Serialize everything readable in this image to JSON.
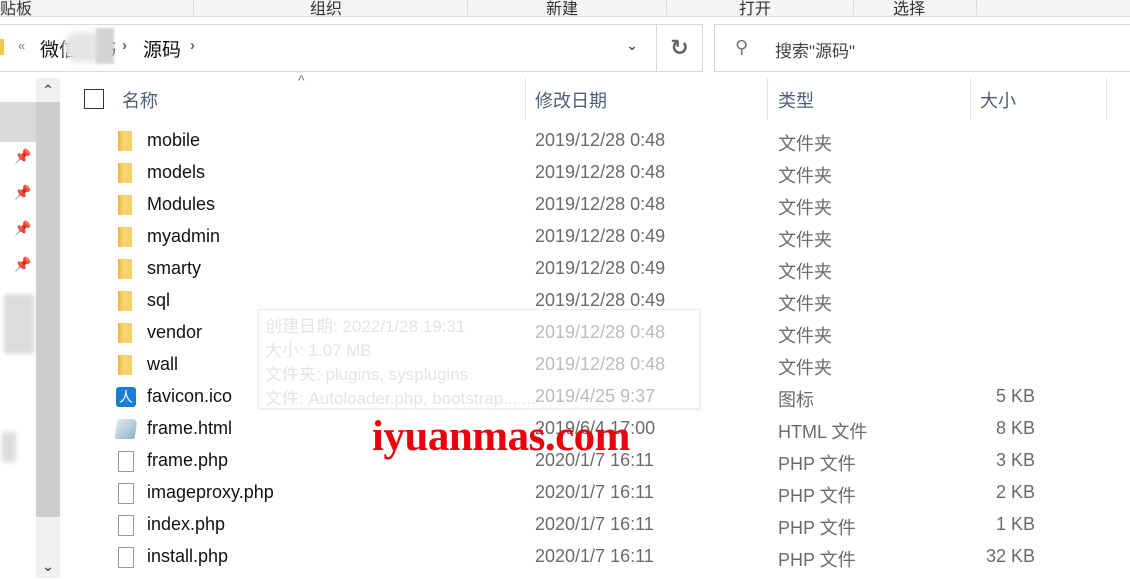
{
  "ribbon": {
    "groups": [
      "贴板",
      "组织",
      "新建",
      "打开",
      "选择"
    ]
  },
  "address_bar": {
    "overflow_label": "«",
    "crumbs": [
      "微信读书",
      "源码"
    ],
    "crumb_separator": "›",
    "dropdown_icon": "chevron-down",
    "refresh_icon": "refresh"
  },
  "search": {
    "placeholder": "搜索\"源码\"",
    "icon": "search"
  },
  "columns": {
    "name": "名称",
    "date": "修改日期",
    "type": "类型",
    "size": "大小",
    "sort_indicator": "^"
  },
  "files": [
    {
      "name": "mobile",
      "date": "2019/12/28 0:48",
      "type": "文件夹",
      "size": "",
      "icon": "folder"
    },
    {
      "name": "models",
      "date": "2019/12/28 0:48",
      "type": "文件夹",
      "size": "",
      "icon": "folder"
    },
    {
      "name": "Modules",
      "date": "2019/12/28 0:48",
      "type": "文件夹",
      "size": "",
      "icon": "folder"
    },
    {
      "name": "myadmin",
      "date": "2019/12/28 0:49",
      "type": "文件夹",
      "size": "",
      "icon": "folder"
    },
    {
      "name": "smarty",
      "date": "2019/12/28 0:49",
      "type": "文件夹",
      "size": "",
      "icon": "folder"
    },
    {
      "name": "sql",
      "date": "2019/12/28 0:49",
      "type": "文件夹",
      "size": "",
      "icon": "folder"
    },
    {
      "name": "vendor",
      "date": "2019/12/28 0:48",
      "type": "文件夹",
      "size": "",
      "icon": "folder"
    },
    {
      "name": "wall",
      "date": "2019/12/28 0:48",
      "type": "文件夹",
      "size": "",
      "icon": "folder"
    },
    {
      "name": "favicon.ico",
      "date": "2019/4/25 9:37",
      "type": "图标",
      "size": "5 KB",
      "icon": "favicon"
    },
    {
      "name": "frame.html",
      "date": "2019/6/4 17:00",
      "type": "HTML 文件",
      "size": "8 KB",
      "icon": "html"
    },
    {
      "name": "frame.php",
      "date": "2020/1/7 16:11",
      "type": "PHP 文件",
      "size": "3 KB",
      "icon": "file"
    },
    {
      "name": "imageproxy.php",
      "date": "2020/1/7 16:11",
      "type": "PHP 文件",
      "size": "2 KB",
      "icon": "file"
    },
    {
      "name": "index.php",
      "date": "2020/1/7 16:11",
      "type": "PHP 文件",
      "size": "1 KB",
      "icon": "file"
    },
    {
      "name": "install.php",
      "date": "2020/1/7 16:11",
      "type": "PHP 文件",
      "size": "32 KB",
      "icon": "file"
    }
  ],
  "tooltip": {
    "lines": [
      "创建日期: 2022/1/28 19:31",
      "大小: 1.07 MB",
      "文件夹: plugins, sysplugins",
      "文件: Autoloader.php, bootstrap...  ..."
    ]
  },
  "watermark": "iyuanmas.com",
  "nav": {
    "pin_icon": "pin",
    "scroll_up_icon": "chevron-up",
    "scroll_down_icon": "chevron-down"
  }
}
